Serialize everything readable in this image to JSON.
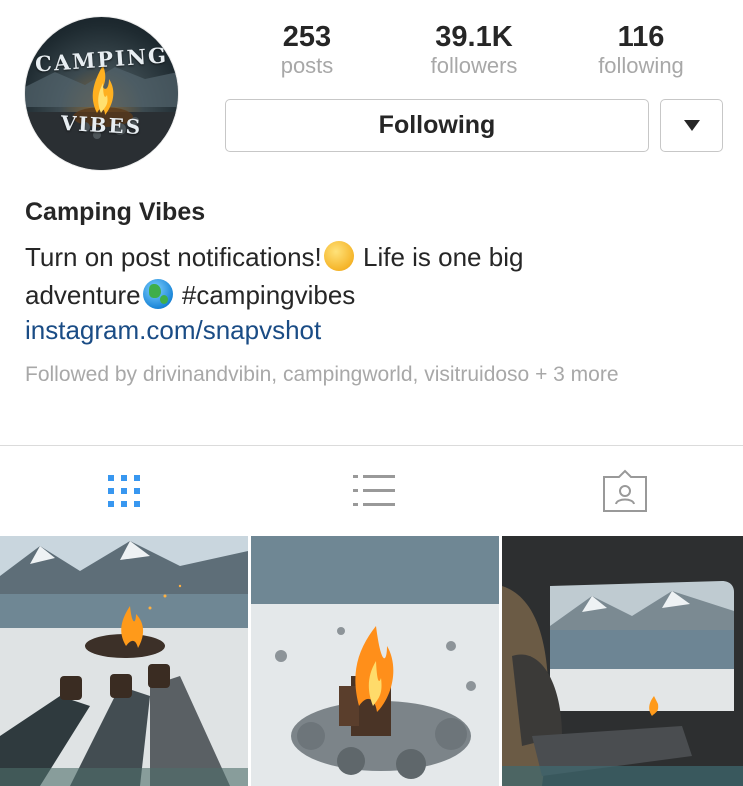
{
  "profile": {
    "avatar_text_top": "CAMPING",
    "avatar_text_bottom": "VIBES",
    "name": "Camping Vibes",
    "bio_line1_a": "Turn on post notifications!",
    "bio_line1_b": " Life is one big",
    "bio_line2_a": "adventure",
    "bio_line2_b": "  #campingvibes",
    "link": "instagram.com/snapvshot",
    "followed_by": "Followed by drivinandvibin, campingworld, visitruidoso + 3 more"
  },
  "stats": {
    "posts": {
      "value": "253",
      "label": "posts"
    },
    "followers": {
      "value": "39.1K",
      "label": "followers"
    },
    "following": {
      "value": "116",
      "label": "following"
    }
  },
  "buttons": {
    "follow_label": "Following",
    "dropdown_icon": "triangle-down-icon"
  },
  "tabs": [
    {
      "icon": "grid-icon",
      "active": true
    },
    {
      "icon": "list-icon",
      "active": false
    },
    {
      "icon": "tagged-icon",
      "active": false
    }
  ],
  "emoji": {
    "smile": "smiling-face-emoji",
    "globe": "globe-emoji"
  },
  "colors": {
    "active_tab": "#3897f0",
    "inactive_tab": "#999999",
    "link": "#1a4c85",
    "muted": "#a8a8a8"
  },
  "posts": [
    {
      "scene": "campfire-lake-feet"
    },
    {
      "scene": "campfire-closeup"
    },
    {
      "scene": "van-view-lake"
    }
  ]
}
